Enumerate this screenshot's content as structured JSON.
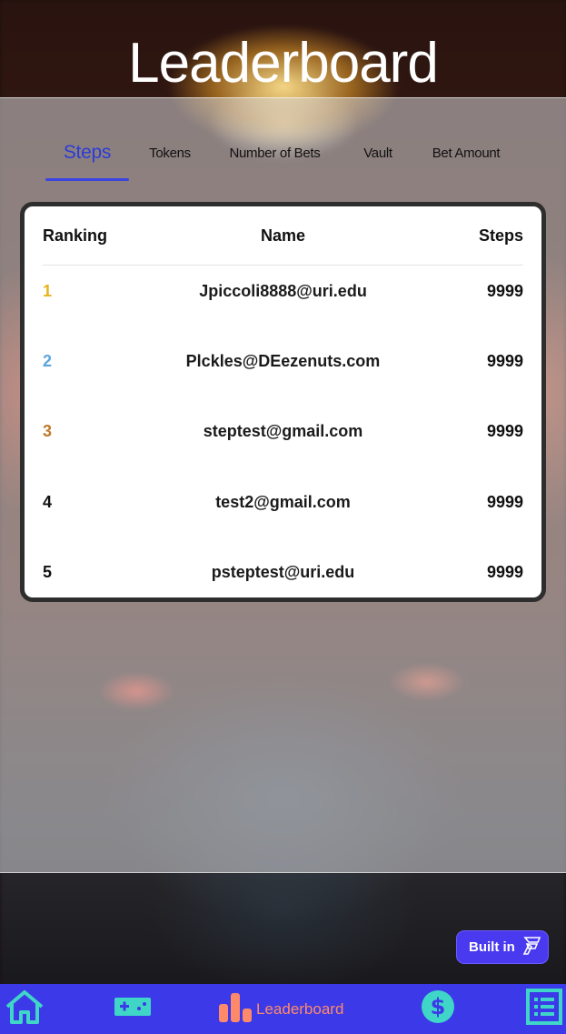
{
  "header": {
    "title": "Leaderboard"
  },
  "tabs": [
    {
      "label": "Steps",
      "active": true
    },
    {
      "label": "Tokens",
      "active": false
    },
    {
      "label": "Number of Bets",
      "active": false
    },
    {
      "label": "Vault",
      "active": false
    },
    {
      "label": "Bet Amount",
      "active": false
    }
  ],
  "table": {
    "columns": [
      "Ranking",
      "Name",
      "Steps"
    ],
    "rows": [
      {
        "rank": "1",
        "name": "Jpiccoli8888@uri.edu",
        "steps": "9999",
        "rank_color": "#e8b21c"
      },
      {
        "rank": "2",
        "name": "Plckles@DEezenuts.com",
        "steps": "9999",
        "rank_color": "#5aa6e0"
      },
      {
        "rank": "3",
        "name": "steptest@gmail.com",
        "steps": "9999",
        "rank_color": "#c07a2c"
      },
      {
        "rank": "4",
        "name": "test2@gmail.com",
        "steps": "9999",
        "rank_color": "#111111"
      },
      {
        "rank": "5",
        "name": "psteptest@uri.edu",
        "steps": "9999",
        "rank_color": "#111111"
      }
    ]
  },
  "badge": {
    "label": "Built in",
    "icon": "flutterflow-icon"
  },
  "navbar": {
    "items": [
      {
        "icon": "home-icon"
      },
      {
        "icon": "gamepad-icon"
      },
      {
        "icon": "leaderboard-icon",
        "label": "Leaderboard",
        "active": true
      },
      {
        "icon": "dollar-icon"
      },
      {
        "icon": "list-icon"
      }
    ]
  },
  "colors": {
    "accent": "#3b39e8",
    "active_tab": "#2b3bd6",
    "nav_icon": "#3fd6c8",
    "nav_active": "#ff8a6a"
  }
}
